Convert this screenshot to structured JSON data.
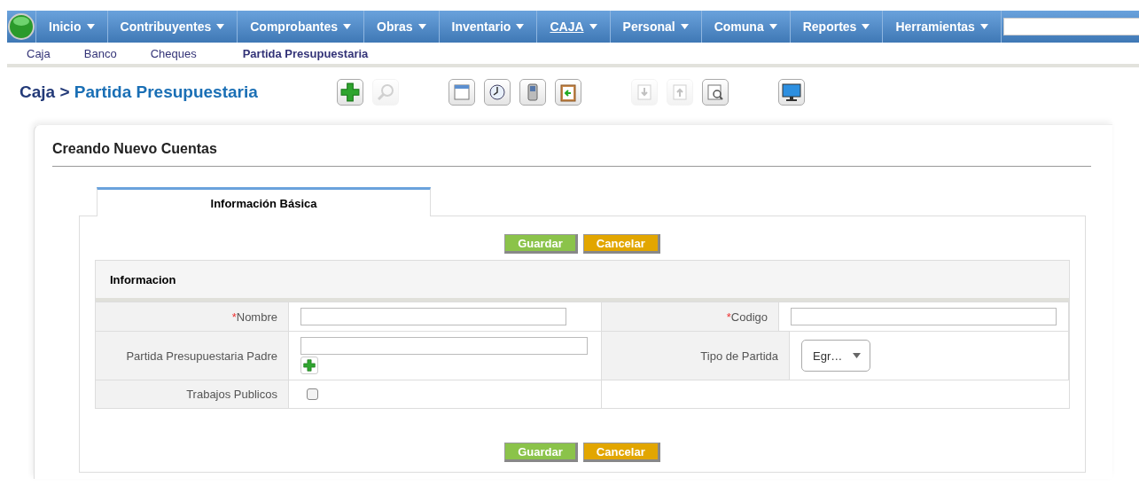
{
  "menu": [
    {
      "label": "Inicio",
      "selected": false
    },
    {
      "label": "Contribuyentes",
      "selected": false
    },
    {
      "label": "Comprobantes",
      "selected": false
    },
    {
      "label": "Obras",
      "selected": false
    },
    {
      "label": "Inventario",
      "selected": false
    },
    {
      "label": "CAJA",
      "selected": true
    },
    {
      "label": "Personal",
      "selected": false
    },
    {
      "label": "Comuna",
      "selected": false
    },
    {
      "label": "Reportes",
      "selected": false
    },
    {
      "label": "Herramientas",
      "selected": false
    }
  ],
  "submenu": [
    {
      "label": "Caja",
      "selected": false
    },
    {
      "label": "Banco",
      "selected": false
    },
    {
      "label": "Cheques",
      "selected": false
    },
    {
      "label": "Partida Presupuestaria",
      "selected": true
    }
  ],
  "breadcrumb": {
    "parent": "Caja",
    "separator": ">",
    "current": "Partida Presupuestaria"
  },
  "toolbar": [
    [
      {
        "kind": "add",
        "disabled": false
      },
      {
        "kind": "search",
        "disabled": true
      }
    ],
    [
      {
        "kind": "calendar",
        "disabled": false
      },
      {
        "kind": "clock",
        "disabled": false
      },
      {
        "kind": "phone",
        "disabled": false
      },
      {
        "kind": "clipboard",
        "disabled": false
      }
    ],
    [
      {
        "kind": "download",
        "disabled": true
      },
      {
        "kind": "upload",
        "disabled": true
      },
      {
        "kind": "report",
        "disabled": false
      }
    ],
    [
      {
        "kind": "monitor",
        "disabled": false
      }
    ]
  ],
  "form": {
    "title": "Creando Nuevo Cuentas",
    "tabs": [
      {
        "label": "Información Básica",
        "selected": true
      }
    ],
    "buttons": [
      {
        "kind": "save",
        "label": "Guardar"
      },
      {
        "kind": "cancel",
        "label": "Cancelar"
      }
    ],
    "section": "Informacion",
    "rows": [
      [
        {
          "label": "Nombre",
          "mark": "*",
          "kind": "text"
        },
        {
          "label": "Codigo",
          "mark": "*",
          "kind": "text"
        }
      ],
      [
        {
          "label": "Partida Presupuestaria Padre",
          "kind": "text_add"
        },
        {
          "label": "Tipo de Partida",
          "kind": "select",
          "value": "Egr…"
        }
      ],
      [
        {
          "label": "Trabajos Publicos",
          "kind": "checkbox",
          "checked": false
        }
      ]
    ],
    "bottom_buttons": [
      {
        "kind": "save",
        "label": "Guardar"
      },
      {
        "kind": "cancel",
        "label": "Cancelar"
      }
    ]
  }
}
